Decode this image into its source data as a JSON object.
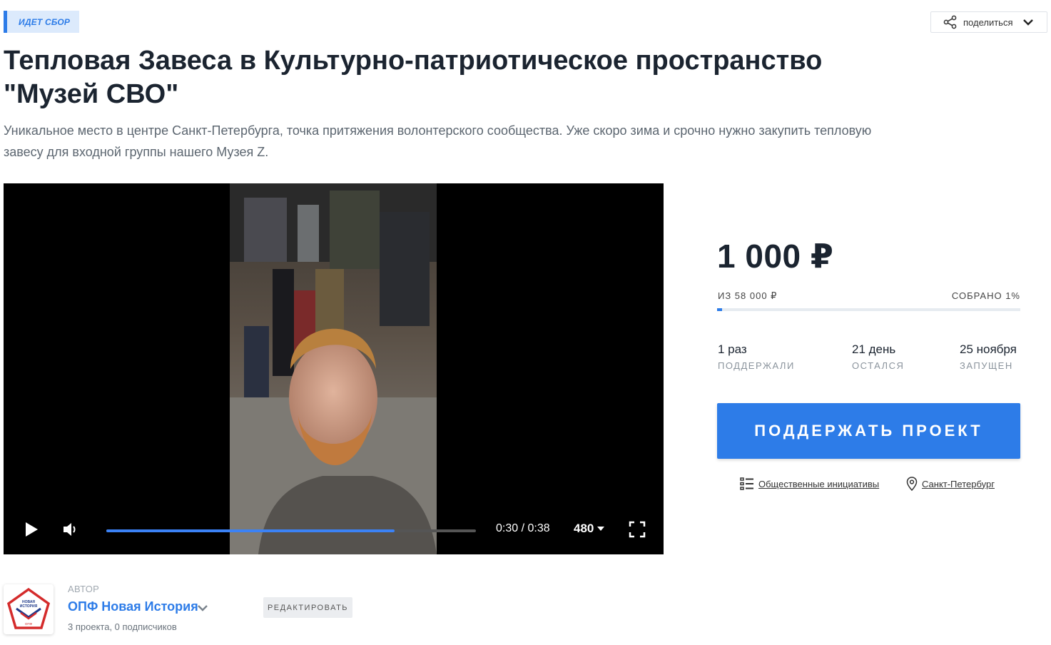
{
  "status_badge": "ИДЕТ СБОР",
  "share": {
    "label": "поделиться",
    "icon": "share-icon"
  },
  "project": {
    "title": "Тепловая Завеса в Культурно-патриотическое пространство \"Музей СВО\"",
    "description": "Уникальное место в центре Санкт-Петербурга, точка притяжения волонтерского сообщества. Уже скоро зима и срочно нужно закупить тепловую завесу для входной группы нашего Музея Z."
  },
  "video": {
    "time_current": "0:30",
    "time_separator": "/",
    "time_total": "0:38",
    "played_fraction": 0.78,
    "quality": "480"
  },
  "funding": {
    "amount": "1 000 ₽",
    "goal": "ИЗ 58 000 ₽",
    "collected": "СОБРАНО 1%",
    "percent": 1,
    "stats": [
      {
        "value": "1 раз",
        "label": "ПОДДЕРЖАЛИ"
      },
      {
        "value": "21 день",
        "label": "ОСТАЛСЯ"
      },
      {
        "value": "25 ноября",
        "label": "ЗАПУЩЕН"
      }
    ],
    "support_button": "ПОДДЕРЖАТЬ ПРОЕКТ",
    "category": "Общественные инициативы",
    "location": "Санкт-Петербург"
  },
  "author": {
    "caption": "АВТОР",
    "name": "ОПФ Новая История",
    "stats": "3 проекта, 0 подписчиков",
    "edit_button": "РЕДАКТИРОВАТЬ",
    "logo_text": [
      "НОВАЯ",
      "ИСТОРИЯ",
      "ОПФ"
    ]
  },
  "colors": {
    "accent": "#2d7ce8",
    "badge_bg": "#dceafc",
    "text": "#1b2430"
  }
}
